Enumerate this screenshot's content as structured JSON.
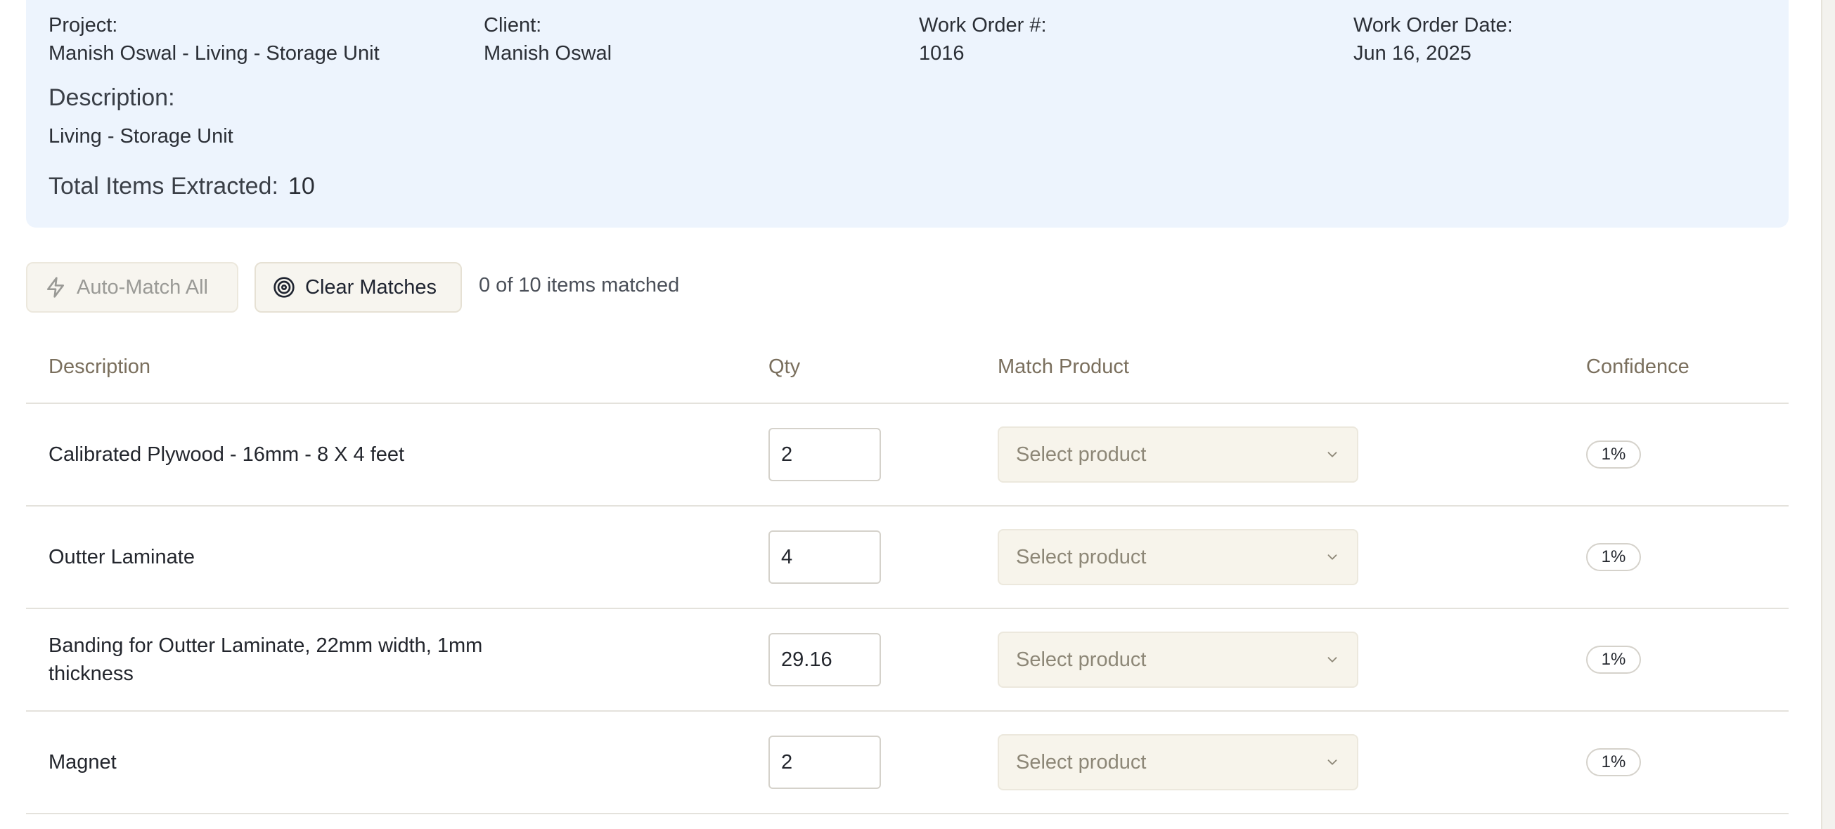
{
  "work_order": {
    "project_label": "Project:",
    "project_value": "Manish Oswal - Living - Storage Unit",
    "client_label": "Client:",
    "client_value": "Manish Oswal",
    "number_label": "Work Order #:",
    "number_value": "1016",
    "date_label": "Work Order Date:",
    "date_value": "Jun 16, 2025",
    "description_label": "Description:",
    "description_value": "Living - Storage Unit",
    "total_label": "Total Items Extracted:",
    "total_value": "10"
  },
  "toolbar": {
    "auto_match_label": "Auto-Match All",
    "auto_match_icon": "lightning-icon",
    "clear_label": "Clear Matches",
    "clear_icon": "target-icon",
    "match_status": "0 of 10 items matched"
  },
  "table": {
    "headers": {
      "description": "Description",
      "qty": "Qty",
      "match_product": "Match Product",
      "confidence": "Confidence"
    },
    "rows": [
      {
        "description": "Calibrated Plywood - 16mm - 8 X 4 feet",
        "qty": "2",
        "product_placeholder": "Select product",
        "confidence": "1%"
      },
      {
        "description": "Outter Laminate",
        "qty": "4",
        "product_placeholder": "Select product",
        "confidence": "1%"
      },
      {
        "description": "Banding for Outter Laminate, 22mm width, 1mm thickness",
        "qty": "29.16",
        "product_placeholder": "Select product",
        "confidence": "1%"
      },
      {
        "description": "Magnet",
        "qty": "2",
        "product_placeholder": "Select product",
        "confidence": "1%"
      }
    ]
  },
  "colors": {
    "panel_bg": "#edf4fd",
    "header_text": "#7a6f5d",
    "select_bg": "#f7f4eb"
  }
}
